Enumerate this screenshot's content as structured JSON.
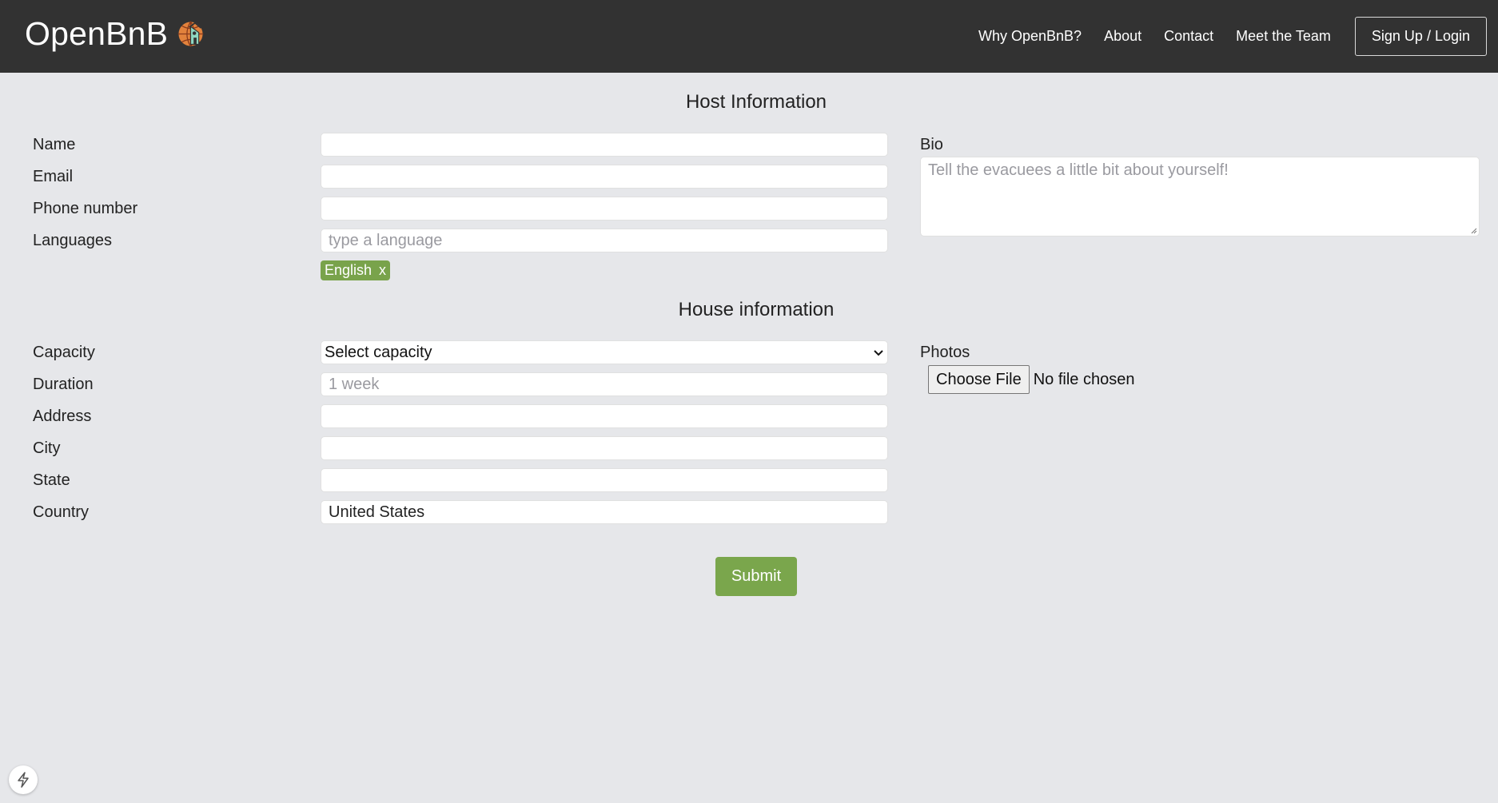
{
  "navbar": {
    "brand": "OpenBnB",
    "links": [
      "Why OpenBnB?",
      "About",
      "Contact",
      "Meet the Team"
    ],
    "login_label": "Sign Up / Login"
  },
  "host_section": {
    "title": "Host Information",
    "labels": {
      "name": "Name",
      "email": "Email",
      "phone": "Phone number",
      "languages": "Languages",
      "bio": "Bio"
    },
    "values": {
      "name": "",
      "email": "",
      "phone": ""
    },
    "languages_placeholder": "type a language",
    "language_tags": [
      {
        "label": "English",
        "remove": "x"
      }
    ],
    "bio_placeholder": "Tell the evacuees a little bit about yourself!"
  },
  "house_section": {
    "title": "House information",
    "labels": {
      "capacity": "Capacity",
      "duration": "Duration",
      "address": "Address",
      "city": "City",
      "state": "State",
      "country": "Country",
      "photos": "Photos"
    },
    "capacity_selected": "Select capacity",
    "duration_placeholder": "1 week",
    "values": {
      "address": "",
      "city": "",
      "state": "",
      "country": "United States"
    },
    "file_button": "Choose File",
    "file_status": "No file chosen"
  },
  "submit_label": "Submit",
  "colors": {
    "navbar_bg": "#323232",
    "accent_green": "#79a34b",
    "page_bg": "#e6e7ea"
  },
  "icons": {
    "brand_logo": "globe-house-icon",
    "dropdown": "chevron-down-icon",
    "corner": "lightning-bolt-icon"
  }
}
